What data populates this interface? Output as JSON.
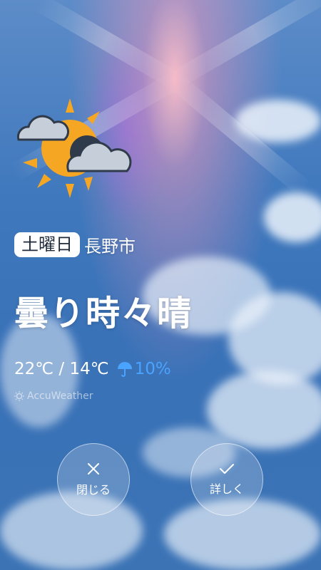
{
  "weather": {
    "icon": "sun-behind-clouds-icon",
    "day": "土曜日",
    "city": "長野市",
    "condition": "曇り時々晴",
    "high": "22℃",
    "separator": " / ",
    "low": "14℃",
    "precip_icon": "umbrella-icon",
    "precip": "10%",
    "provider": "AccuWeather"
  },
  "actions": {
    "close_label": "閉じる",
    "details_label": "詳しく"
  },
  "colors": {
    "sun": "#f5a623",
    "cloud": "#c6cfd9",
    "precip": "#4aa3ff"
  }
}
